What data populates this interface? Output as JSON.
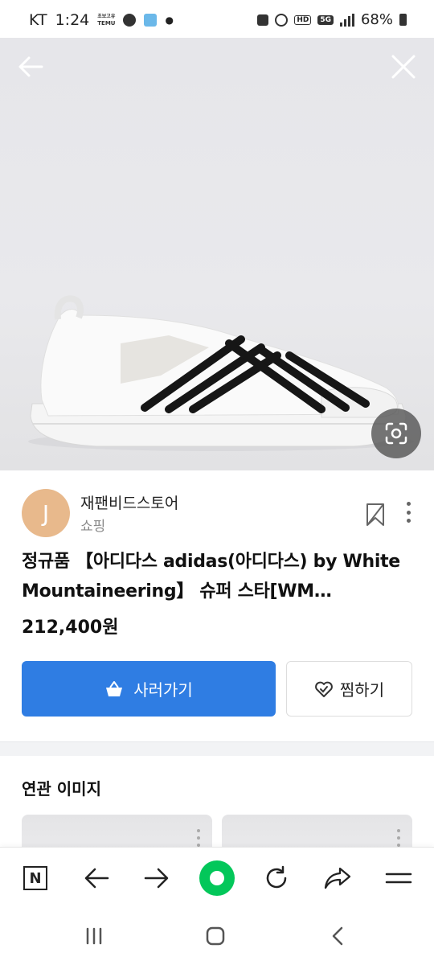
{
  "status_bar": {
    "carrier": "KT",
    "time": "1:24",
    "mini_label_top": "초보고유",
    "mini_label_bottom": "TEMU",
    "battery": "68%",
    "network_badge": "5G",
    "hd_badge": "HD"
  },
  "hero": {
    "back_icon": "arrow-left-icon",
    "close_icon": "close-icon",
    "lens_icon": "lens-search-icon"
  },
  "seller": {
    "avatar_initial": "J",
    "name": "재팬비드스토어",
    "category": "쇼핑"
  },
  "product": {
    "title": "정규품 【아디다스 adidas(아디다스) by White Mountaineering】 슈퍼 스타[WM SUPERSTAR SLIP ON]",
    "price": "212,400원"
  },
  "actions": {
    "buy_label": "사러가기",
    "wish_label": "찜하기"
  },
  "related": {
    "title": "연관 이미지"
  },
  "colors": {
    "buy_button": "#2f7de3",
    "naver_green": "#03c75a",
    "avatar": "#e8b98c"
  },
  "toolbar": {
    "home_label": "N"
  }
}
